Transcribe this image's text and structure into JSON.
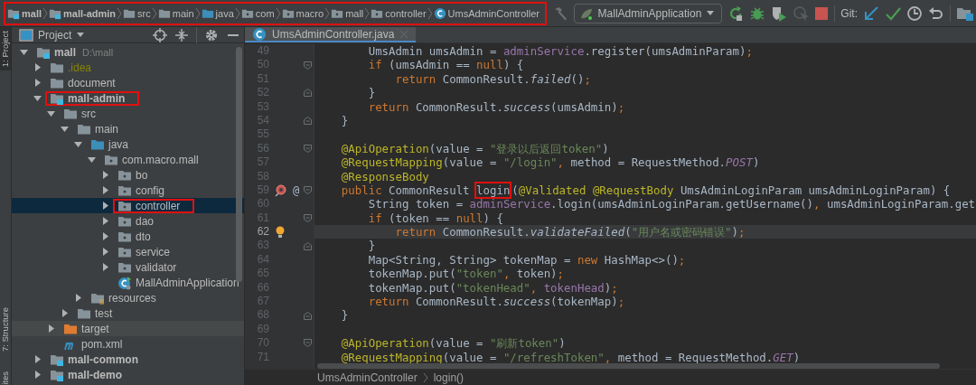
{
  "breadcrumb": {
    "highlighted": true,
    "items": [
      {
        "label": "mall",
        "kind": "module"
      },
      {
        "label": "mall-admin",
        "kind": "module"
      },
      {
        "label": "src",
        "kind": "folder"
      },
      {
        "label": "main",
        "kind": "folder"
      },
      {
        "label": "java",
        "kind": "source_folder"
      },
      {
        "label": "com",
        "kind": "package"
      },
      {
        "label": "macro",
        "kind": "package"
      },
      {
        "label": "mall",
        "kind": "package"
      },
      {
        "label": "controller",
        "kind": "package"
      },
      {
        "label": "UmsAdminController",
        "kind": "class"
      }
    ]
  },
  "toolbar": {
    "run_config": "MallAdminApplication",
    "vcs_label": "Git:"
  },
  "side_tabs": [
    {
      "label": "1: Project",
      "selected": true
    },
    {
      "label": "7: Structure",
      "selected": false
    },
    {
      "label": "ites",
      "selected": false
    }
  ],
  "project_panel": {
    "title": "Project",
    "tree": [
      {
        "label": "mall",
        "kind": "module",
        "hint": "D:\\mall",
        "expanded": true,
        "selected": false,
        "highlighted": false,
        "children": [
          {
            "label": ".idea",
            "kind": "ignored_folder",
            "expanded": false,
            "selected": false,
            "highlighted": false
          },
          {
            "label": "document",
            "kind": "folder",
            "expanded": false,
            "selected": false,
            "highlighted": false
          },
          {
            "label": "mall-admin",
            "kind": "module",
            "expanded": true,
            "selected": false,
            "highlighted": true,
            "children": [
              {
                "label": "src",
                "kind": "folder",
                "expanded": true,
                "selected": false,
                "highlighted": false,
                "children": [
                  {
                    "label": "main",
                    "kind": "folder",
                    "expanded": true,
                    "selected": false,
                    "highlighted": false,
                    "children": [
                      {
                        "label": "java",
                        "kind": "source_folder",
                        "expanded": true,
                        "selected": false,
                        "highlighted": false,
                        "children": [
                          {
                            "label": "com.macro.mall",
                            "kind": "package",
                            "expanded": true,
                            "selected": false,
                            "highlighted": false,
                            "children": [
                              {
                                "label": "bo",
                                "kind": "package",
                                "expanded": false,
                                "selected": false,
                                "highlighted": false
                              },
                              {
                                "label": "config",
                                "kind": "package",
                                "expanded": false,
                                "selected": false,
                                "highlighted": false
                              },
                              {
                                "label": "controller",
                                "kind": "package",
                                "expanded": false,
                                "selected": true,
                                "highlighted": true
                              },
                              {
                                "label": "dao",
                                "kind": "package",
                                "expanded": false,
                                "selected": false,
                                "highlighted": false
                              },
                              {
                                "label": "dto",
                                "kind": "package",
                                "expanded": false,
                                "selected": false,
                                "highlighted": false
                              },
                              {
                                "label": "service",
                                "kind": "package",
                                "expanded": false,
                                "selected": false,
                                "highlighted": false
                              },
                              {
                                "label": "validator",
                                "kind": "package",
                                "expanded": false,
                                "selected": false,
                                "highlighted": false
                              },
                              {
                                "label": "MallAdminApplication",
                                "kind": "app_class",
                                "selected": false,
                                "highlighted": false
                              }
                            ]
                          }
                        ]
                      },
                      {
                        "label": "resources",
                        "kind": "resources",
                        "expanded": false,
                        "selected": false,
                        "highlighted": false
                      }
                    ]
                  },
                  {
                    "label": "test",
                    "kind": "folder",
                    "expanded": false,
                    "selected": false,
                    "highlighted": false
                  }
                ]
              },
              {
                "label": "target",
                "kind": "excluded",
                "expanded": false,
                "selected": false,
                "highlighted": false
              },
              {
                "label": "pom.xml",
                "kind": "maven",
                "selected": false,
                "highlighted": false
              }
            ]
          },
          {
            "label": "mall-common",
            "kind": "module",
            "expanded": false,
            "selected": false,
            "highlighted": false
          },
          {
            "label": "mall-demo",
            "kind": "module",
            "expanded": false,
            "selected": false,
            "highlighted": false
          }
        ]
      }
    ]
  },
  "editor": {
    "tab": {
      "label": "UmsAdminController.java",
      "selected": true
    },
    "lines": [
      {
        "number": "49",
        "current": false,
        "tokens": [
          {
            "text": "        UmsAdmin umsAdmin = ",
            "kind": "plain"
          },
          {
            "text": "adminService",
            "kind": "field"
          },
          {
            "text": ".register(umsAdminParam)",
            "kind": "plain"
          },
          {
            "text": ";",
            "kind": "keyword"
          }
        ]
      },
      {
        "number": "50",
        "current": false,
        "gutter": [
          {
            "kind": "fold_start"
          }
        ],
        "tokens": [
          {
            "text": "        if",
            "kind": "keyword"
          },
          {
            "text": " (umsAdmin == ",
            "kind": "plain"
          },
          {
            "text": "null",
            "kind": "keyword"
          },
          {
            "text": ") {",
            "kind": "plain"
          }
        ]
      },
      {
        "number": "51",
        "current": false,
        "tokens": [
          {
            "text": "            return",
            "kind": "keyword"
          },
          {
            "text": " CommonResult.",
            "kind": "plain"
          },
          {
            "text": "failed",
            "kind": "static"
          },
          {
            "text": "()",
            "kind": "plain"
          },
          {
            "text": ";",
            "kind": "keyword"
          }
        ]
      },
      {
        "number": "52",
        "current": false,
        "gutter": [
          {
            "kind": "fold_end"
          }
        ],
        "tokens": [
          {
            "text": "        }",
            "kind": "plain"
          }
        ]
      },
      {
        "number": "53",
        "current": false,
        "tokens": [
          {
            "text": "        return",
            "kind": "keyword"
          },
          {
            "text": " CommonResult.",
            "kind": "plain"
          },
          {
            "text": "success",
            "kind": "static"
          },
          {
            "text": "(umsAdmin)",
            "kind": "plain"
          },
          {
            "text": ";",
            "kind": "keyword"
          }
        ]
      },
      {
        "number": "54",
        "current": false,
        "gutter": [
          {
            "kind": "fold_end"
          }
        ],
        "tokens": [
          {
            "text": "    }",
            "kind": "plain"
          }
        ]
      },
      {
        "number": "55",
        "current": false
      },
      {
        "number": "56",
        "current": false,
        "gutter": [
          {
            "kind": "fold_start"
          }
        ],
        "tokens": [
          {
            "text": "    @ApiOperation",
            "kind": "annotation"
          },
          {
            "text": "(value = ",
            "kind": "plain"
          },
          {
            "text": "\"登录以后返回token\"",
            "kind": "string"
          },
          {
            "text": ")",
            "kind": "plain"
          }
        ]
      },
      {
        "number": "57",
        "current": false,
        "tokens": [
          {
            "text": "    @RequestMapping",
            "kind": "annotation"
          },
          {
            "text": "(value = ",
            "kind": "plain"
          },
          {
            "text": "\"/login\"",
            "kind": "string"
          },
          {
            "text": ", ",
            "kind": "keyword"
          },
          {
            "text": "method = RequestMethod.",
            "kind": "plain"
          },
          {
            "text": "POST",
            "kind": "constant"
          },
          {
            "text": ")",
            "kind": "plain"
          }
        ]
      },
      {
        "number": "58",
        "current": false,
        "tokens": [
          {
            "text": "    @ResponseBody",
            "kind": "annotation"
          }
        ]
      },
      {
        "number": "59",
        "current": false,
        "gutter": [
          {
            "kind": "implemented"
          },
          {
            "kind": "text",
            "text": "@"
          },
          {
            "kind": "fold_start"
          }
        ],
        "tokens": [
          {
            "text": "    public ",
            "kind": "keyword"
          },
          {
            "text": "CommonResult ",
            "kind": "plain"
          },
          {
            "text": "login",
            "kind": "plain",
            "boxed": true
          },
          {
            "text": "(",
            "kind": "plain"
          },
          {
            "text": "@Validated @RequestBody ",
            "kind": "annotation"
          },
          {
            "text": "UmsAdminLoginParam umsAdminLoginParam) {",
            "kind": "plain"
          }
        ]
      },
      {
        "number": "60",
        "current": false,
        "tokens": [
          {
            "text": "        String token = ",
            "kind": "plain"
          },
          {
            "text": "adminService",
            "kind": "field"
          },
          {
            "text": ".login(umsAdminLoginParam.getUsername()",
            "kind": "plain"
          },
          {
            "text": ", ",
            "kind": "keyword"
          },
          {
            "text": "umsAdminLoginParam.get",
            "kind": "plain"
          }
        ]
      },
      {
        "number": "61",
        "current": false,
        "gutter": [
          {
            "kind": "fold_start"
          }
        ],
        "tokens": [
          {
            "text": "        if",
            "kind": "keyword"
          },
          {
            "text": " (token == ",
            "kind": "plain"
          },
          {
            "text": "null",
            "kind": "keyword"
          },
          {
            "text": ") {",
            "kind": "plain"
          }
        ]
      },
      {
        "number": "62",
        "current": true,
        "gutter": [
          {
            "kind": "bulb"
          }
        ],
        "tokens": [
          {
            "text": "            return",
            "kind": "keyword"
          },
          {
            "text": " CommonResult.",
            "kind": "plain"
          },
          {
            "text": "validateFailed",
            "kind": "static"
          },
          {
            "text": "(",
            "kind": "plain"
          },
          {
            "text": "\"用户名或密码错误\"",
            "kind": "string"
          },
          {
            "text": ")",
            "kind": "plain"
          },
          {
            "text": ";",
            "kind": "keyword"
          }
        ]
      },
      {
        "number": "63",
        "current": false,
        "gutter": [
          {
            "kind": "fold_end"
          }
        ],
        "tokens": [
          {
            "text": "        }",
            "kind": "plain"
          }
        ]
      },
      {
        "number": "64",
        "current": false,
        "tokens": [
          {
            "text": "        Map<String, String> tokenMap = ",
            "kind": "plain"
          },
          {
            "text": "new ",
            "kind": "keyword"
          },
          {
            "text": "HashMap<>()",
            "kind": "plain"
          },
          {
            "text": ";",
            "kind": "keyword"
          }
        ]
      },
      {
        "number": "65",
        "current": false,
        "tokens": [
          {
            "text": "        tokenMap.put(",
            "kind": "plain"
          },
          {
            "text": "\"token\"",
            "kind": "string"
          },
          {
            "text": ", ",
            "kind": "keyword"
          },
          {
            "text": "token)",
            "kind": "plain"
          },
          {
            "text": ";",
            "kind": "keyword"
          }
        ]
      },
      {
        "number": "66",
        "current": false,
        "tokens": [
          {
            "text": "        tokenMap.put(",
            "kind": "plain"
          },
          {
            "text": "\"tokenHead\"",
            "kind": "string"
          },
          {
            "text": ", ",
            "kind": "keyword"
          },
          {
            "text": "tokenHead",
            "kind": "field"
          },
          {
            "text": ")",
            "kind": "plain"
          },
          {
            "text": ";",
            "kind": "keyword"
          }
        ]
      },
      {
        "number": "67",
        "current": false,
        "tokens": [
          {
            "text": "        return",
            "kind": "keyword"
          },
          {
            "text": " CommonResult.",
            "kind": "plain"
          },
          {
            "text": "success",
            "kind": "static"
          },
          {
            "text": "(tokenMap)",
            "kind": "plain"
          },
          {
            "text": ";",
            "kind": "keyword"
          }
        ]
      },
      {
        "number": "68",
        "current": false,
        "gutter": [
          {
            "kind": "fold_end"
          }
        ],
        "tokens": [
          {
            "text": "    }",
            "kind": "plain"
          }
        ]
      },
      {
        "number": "69",
        "current": false
      },
      {
        "number": "70",
        "current": false,
        "gutter": [
          {
            "kind": "fold_start"
          }
        ],
        "tokens": [
          {
            "text": "    @ApiOperation",
            "kind": "annotation"
          },
          {
            "text": "(value = ",
            "kind": "plain"
          },
          {
            "text": "\"刷新token\"",
            "kind": "string"
          },
          {
            "text": ")",
            "kind": "plain"
          }
        ]
      },
      {
        "number": "71",
        "current": false,
        "tokens": [
          {
            "text": "    @RequestMapping",
            "kind": "annotation"
          },
          {
            "text": "(value = ",
            "kind": "plain"
          },
          {
            "text": "\"/refreshToken\"",
            "kind": "string"
          },
          {
            "text": ", ",
            "kind": "keyword"
          },
          {
            "text": "method = RequestMethod.",
            "kind": "plain"
          },
          {
            "text": "GET",
            "kind": "constant"
          },
          {
            "text": ")",
            "kind": "plain"
          }
        ]
      }
    ],
    "breadcrumbs": [
      "UmsAdminController",
      "login()"
    ]
  }
}
